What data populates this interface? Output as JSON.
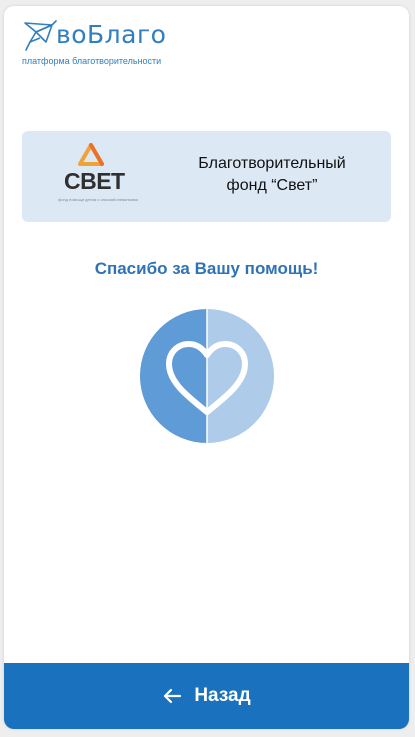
{
  "header": {
    "brand_name": "воБлаго",
    "tagline": "платформа благотворительности"
  },
  "fund": {
    "logo_word": "СВЕТ",
    "logo_subtext": "фонд помощи детям с онкозаболеваниями",
    "name_line1": "Благотворительный",
    "name_line2": "фонд “Свет”"
  },
  "thanks_text": "Спасибо за Вашу помощь!",
  "back_button": {
    "label": "Назад",
    "icon": "arrow-left-icon"
  },
  "colors": {
    "brand_blue": "#2f7fc1",
    "button_blue": "#1a71bd",
    "card_bg": "#dde8f5",
    "heart_dark": "#5f9bd6",
    "heart_light": "#aecbea",
    "logo_orange": "#f0a23a"
  }
}
